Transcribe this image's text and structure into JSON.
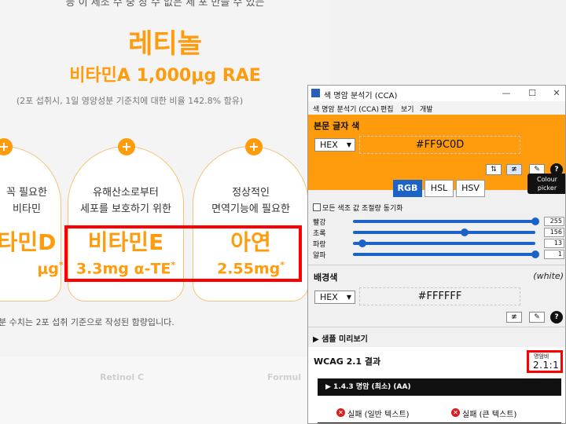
{
  "webpage": {
    "top_text": "등 이 제조 수 중 장 수 없은 세 포 만들 수 있는",
    "retinol_title": "레티놀",
    "retinol_amount": "비타민A 1,000μg RAE",
    "retinol_note": "(2포 섭취시, 1일 영양성분 기준치에 대한 비율 142.8% 함유)",
    "plus_symbol": "+",
    "cards": [
      {
        "desc1": "꼭 필요한",
        "desc2": "비타민",
        "name": "타민D",
        "amount": "μg",
        "mark": "*"
      },
      {
        "desc1": "유해산소로부터",
        "desc2": "세포를 보호하기 위한",
        "name": "비타민E",
        "amount": "3.3mg α-TE",
        "mark": "*"
      },
      {
        "desc1": "정상적인",
        "desc2": "면역기능에 필요한",
        "name": "아연",
        "amount": "2.55mg",
        "mark": "*"
      }
    ],
    "basis_note": "분 수치는 2포 섭취 기준으로 작성된 함량입니다.",
    "footer_words": [
      "Retinol C",
      "Formul"
    ],
    "accent_color": "#FF9C0D",
    "highlight_color": "#FF0000"
  },
  "cca": {
    "title": "색 명암 분석기 (CCA)",
    "window_controls": {
      "minimize": "—",
      "maximize": "☐",
      "close": "✕"
    },
    "menu": [
      "색 명암 분석기 (CCA)",
      "편집",
      "보기",
      "개발"
    ],
    "foreground": {
      "label": "본문 글자 색",
      "format": "HEX",
      "hex": "#FF9C0D",
      "color": "#FF9C0D",
      "tooltip_line1": "Colour",
      "tooltip_line2": "picker"
    },
    "tools": {
      "swap_icon": "⇅",
      "adjust_icon": "≢",
      "picker_icon": "✎",
      "help": "?"
    },
    "tabs": [
      {
        "label": "RGB"
      },
      {
        "label": "HSL"
      },
      {
        "label": "HSV"
      }
    ],
    "sync_label": "모든 색조 값 조절량 동기화",
    "channels": [
      {
        "label": "빨강",
        "value": "255",
        "level": 1.0
      },
      {
        "label": "초록",
        "value": "156",
        "level": 0.612
      },
      {
        "label": "파랑",
        "value": "13",
        "level": 0.051
      },
      {
        "label": "알파",
        "value": "1",
        "level": 1.0
      }
    ],
    "background": {
      "label": "배경색",
      "name": "(white)",
      "format": "HEX",
      "hex": "#FFFFFF"
    },
    "preview_label": "▶ 샘플 미리보기",
    "wcag": {
      "title": "WCAG 2.1 결과",
      "ratio_label": "명암비",
      "ratio_value": "2.1:1",
      "criterion": "▶ 1.4.3 명암 (최소) (AA)",
      "fail_icon": "✕",
      "fail_normal": "실패 (일반 텍스트)",
      "fail_large": "실패 (큰 텍스트)"
    }
  }
}
